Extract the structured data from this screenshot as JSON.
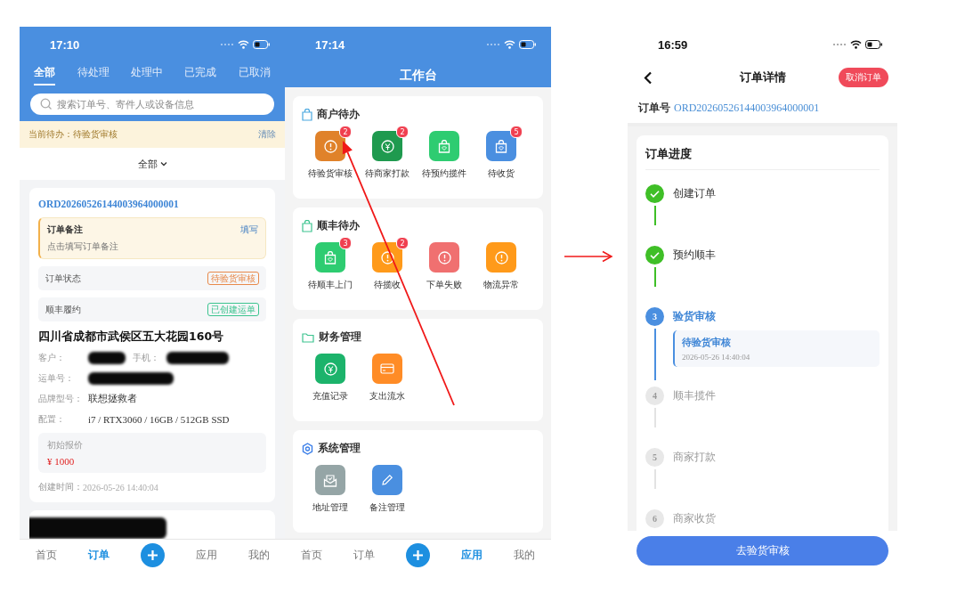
{
  "order_list_screen": {
    "status_bar": {
      "time": "17:10"
    },
    "tabs": [
      {
        "label": "全部",
        "selected": true
      },
      {
        "label": "待处理",
        "selected": false
      },
      {
        "label": "处理中",
        "selected": false
      },
      {
        "label": "已完成",
        "selected": false
      },
      {
        "label": "已取消",
        "selected": false
      }
    ],
    "search": {
      "placeholder": "搜索订单号、寄件人或设备信息"
    },
    "notice": {
      "text": "当前待办：待验货审核",
      "action": "清除"
    },
    "filter": {
      "label": "全部"
    },
    "order_card": {
      "order_id": "ORD20260526144003964000001",
      "note": {
        "title": "订单备注",
        "action": "填写",
        "placeholder": "点击填写订单备注"
      },
      "status_rows": [
        {
          "label": "订单状态",
          "badge": "待验货审核",
          "color": "#e8894a"
        },
        {
          "label": "顺丰履约",
          "badge": "已创建运单",
          "color": "#3cc48f"
        }
      ],
      "address": "四川省成都市武侯区五大花园160号",
      "field_rows": [
        [
          {
            "label": "客户：",
            "redacted": true
          },
          {
            "label": "手机：",
            "redacted": true
          }
        ],
        [
          {
            "label": "运单号：",
            "redacted": true
          }
        ],
        [
          {
            "label": "品牌型号：",
            "redacted": false,
            "value": "联想拯救者"
          }
        ],
        [
          {
            "label": "配置：",
            "redacted": false,
            "value": "i7 / RTX3060 / 16GB / 512GB SSD"
          }
        ]
      ],
      "price": {
        "label": "初始报价",
        "value": "¥ 1000"
      },
      "created": {
        "label": "创建时间：",
        "value": "2026-05-26 14:40:04"
      }
    },
    "tab_bar": [
      {
        "kind": "text",
        "label": "首页",
        "selected": false
      },
      {
        "kind": "text",
        "label": "订单",
        "selected": true
      },
      {
        "kind": "add"
      },
      {
        "kind": "text",
        "label": "应用",
        "selected": false
      },
      {
        "kind": "text",
        "label": "我的",
        "selected": false
      }
    ]
  },
  "workbench_screen": {
    "status_bar": {
      "time": "17:14"
    },
    "title": "工作台",
    "sections": [
      {
        "title": "商户待办",
        "kind": "merchant",
        "items": [
          {
            "label": "待验货审核",
            "kind": "alert",
            "color": "#e0822a",
            "badge": "2"
          },
          {
            "label": "待商家打款",
            "kind": "payment",
            "color": "#1f9a4f",
            "badge": "2"
          },
          {
            "label": "待预约揽件",
            "kind": "bag",
            "color": "#2ecc71"
          },
          {
            "label": "待收货",
            "kind": "bag",
            "color": "#4a8fe0",
            "badge": "5"
          }
        ]
      },
      {
        "title": "顺丰待办",
        "kind": "courier",
        "items": [
          {
            "label": "待顺丰上门",
            "kind": "bag",
            "color": "#2ecc71",
            "badge": "3"
          },
          {
            "label": "待揽收",
            "kind": "alert",
            "color": "#ff9a1a",
            "badge": "2"
          },
          {
            "label": "下单失败",
            "kind": "alert",
            "color": "#f07070"
          },
          {
            "label": "物流异常",
            "kind": "alert",
            "color": "#ff9a1a"
          }
        ]
      },
      {
        "title": "财务管理",
        "kind": "finance",
        "items": [
          {
            "label": "充值记录",
            "kind": "payment",
            "color": "#1cb36b"
          },
          {
            "label": "支出流水",
            "kind": "card",
            "color": "#ff8c26"
          }
        ]
      },
      {
        "title": "系统管理",
        "kind": "system",
        "items": [
          {
            "label": "地址管理",
            "kind": "address",
            "color": "#95a5a6"
          },
          {
            "label": "备注管理",
            "kind": "note",
            "color": "#4a8fe0"
          }
        ]
      }
    ],
    "tab_bar": [
      {
        "kind": "text",
        "label": "首页",
        "selected": false
      },
      {
        "kind": "text",
        "label": "订单",
        "selected": false
      },
      {
        "kind": "add"
      },
      {
        "kind": "text",
        "label": "应用",
        "selected": true
      },
      {
        "kind": "text",
        "label": "我的",
        "selected": false
      }
    ]
  },
  "order_detail_screen": {
    "status_bar": {
      "time": "16:59"
    },
    "title": "订单详情",
    "cancel_button": "取消订单",
    "order_no": {
      "label": "订单号",
      "value": "ORD20260526144003964000001"
    },
    "progress": {
      "title": "订单进度",
      "steps": [
        {
          "kind": "done",
          "label": "创建订单"
        },
        {
          "kind": "done",
          "label": "预约顺丰"
        },
        {
          "kind": "current",
          "number": "3",
          "label": "验货审核",
          "detail": {
            "status": "待验货审核",
            "time": "2026-05-26 14:40:04"
          }
        },
        {
          "kind": "pending",
          "number": "4",
          "label": "顺丰揽件"
        },
        {
          "kind": "pending",
          "number": "5",
          "label": "商家打款"
        },
        {
          "kind": "pending",
          "number": "6",
          "label": "商家收货"
        }
      ]
    },
    "primary_button": "去验货审核"
  }
}
